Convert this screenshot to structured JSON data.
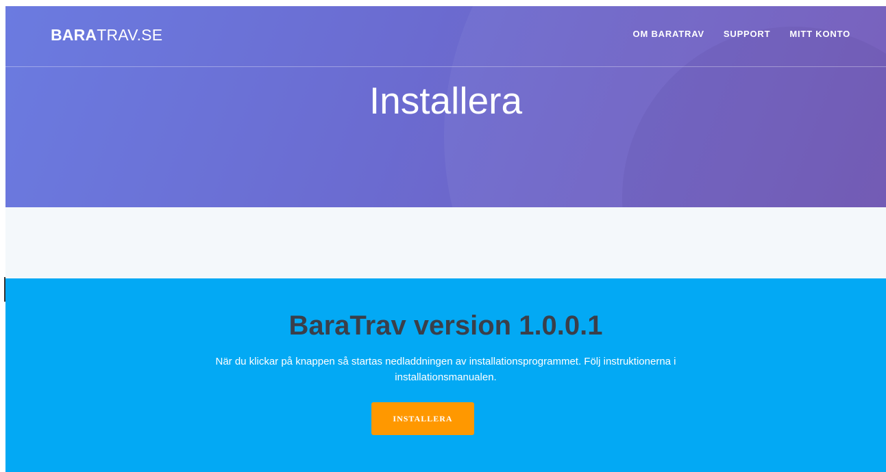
{
  "header": {
    "brand_bold": "BARA",
    "brand_light": "TRAV.SE",
    "nav": [
      "OM BARATRAV",
      "SUPPORT",
      "MITT KONTO"
    ]
  },
  "hero": {
    "title": "Installera"
  },
  "download": {
    "heading": "BaraTrav version 1.0.0.1",
    "text": "När du klickar på knappen så startas nedladdningen av installationsprogrammet. Följ instruktionerna i installationsmanualen.",
    "button_label": "INSTALLERA"
  },
  "colors": {
    "hero_gradient_start": "#6b7be0",
    "hero_gradient_end": "#7258b8",
    "download_bg": "#03a9f4",
    "button_bg": "#ff9800",
    "heading_text": "#3a3f4a"
  }
}
